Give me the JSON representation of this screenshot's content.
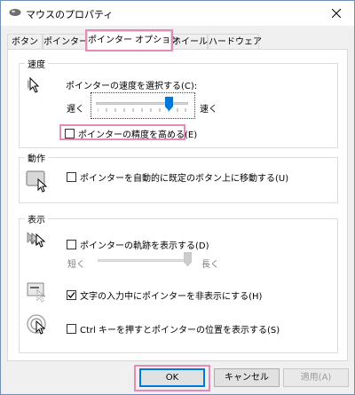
{
  "window": {
    "title": "マウスのプロパティ"
  },
  "tabs": [
    {
      "label": "ボタン"
    },
    {
      "label": "ポインター"
    },
    {
      "label": "ポインター オプション"
    },
    {
      "label": "ホイール"
    },
    {
      "label": "ハードウェア"
    }
  ],
  "active_tab": "ポインター オプション",
  "speed_group": {
    "title": "速度",
    "prompt": "ポインターの速度を選択する(C):",
    "slow": "遅く",
    "fast": "速く",
    "speed_level_fraction": 0.75,
    "precision_label": "ポインターの精度を高める(E)",
    "precision_checked": false
  },
  "snap_group": {
    "title": "動作",
    "snap_label": "ポインターを自動的に既定のボタン上に移動する(U)",
    "snap_checked": false
  },
  "visibility_group": {
    "title": "表示",
    "trails_label": "ポインターの軌跡を表示する(D)",
    "trails_checked": false,
    "short": "短く",
    "long": "長く",
    "trail_level_fraction": 1.0,
    "hide_label": "文字の入力中にポインターを非表示にする(H)",
    "hide_checked": true,
    "ctrl_label": "Ctrl キーを押すとポインターの位置を表示する(S)",
    "ctrl_checked": false
  },
  "buttons": {
    "ok": "OK",
    "cancel": "キャンセル",
    "apply": "適用(A)"
  },
  "colors": {
    "highlight": "#e58bb6",
    "accent": "#0078d7"
  }
}
